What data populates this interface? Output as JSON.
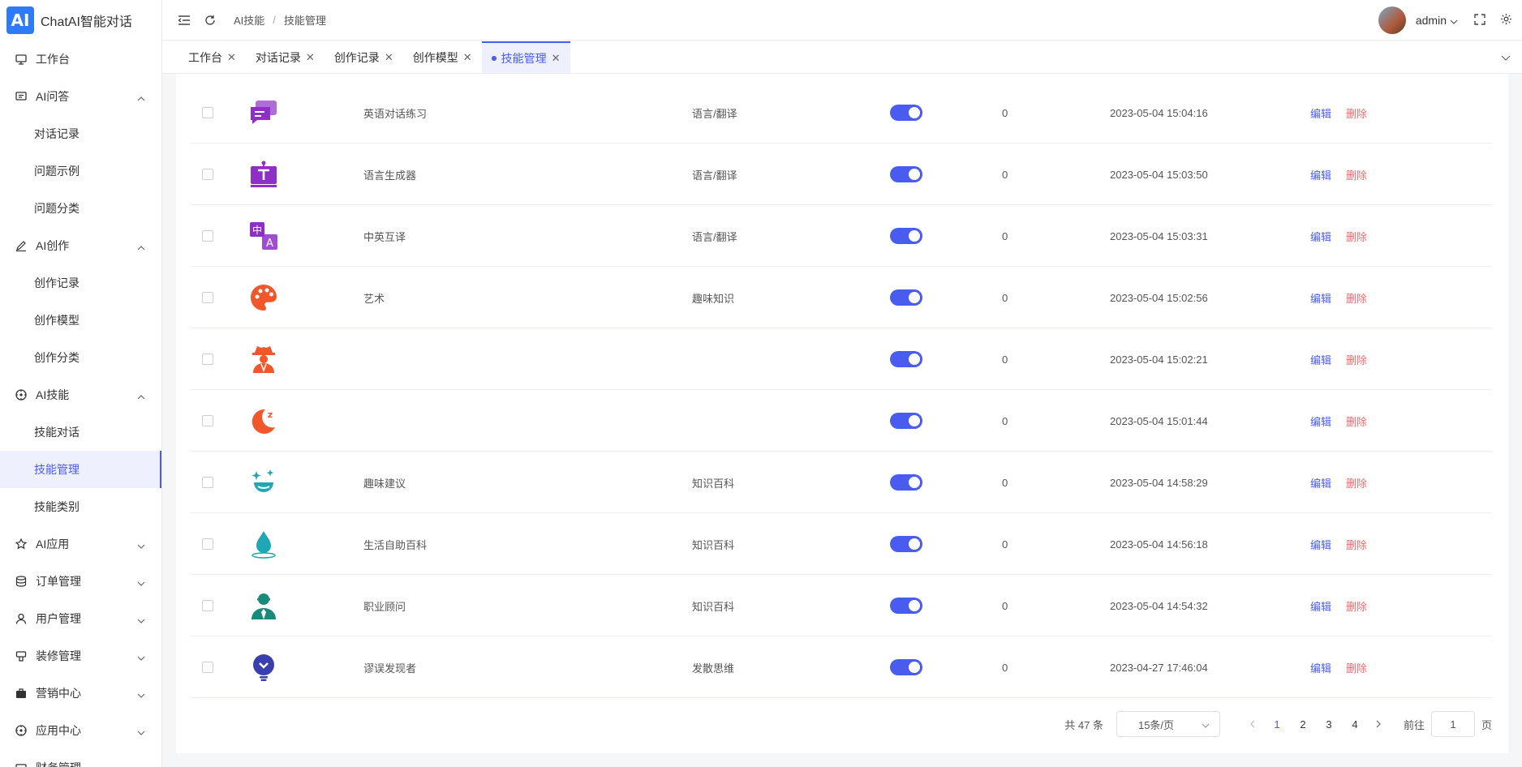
{
  "app": {
    "logo_text": "AI",
    "title": "ChatAI智能对话"
  },
  "sidebar": {
    "items": [
      {
        "label": "工作台",
        "icon": "monitor-icon",
        "expandable": false
      },
      {
        "label": "AI问答",
        "icon": "message-icon",
        "expandable": true,
        "expanded": true,
        "children": [
          {
            "label": "对话记录"
          },
          {
            "label": "问题示例"
          },
          {
            "label": "问题分类"
          }
        ]
      },
      {
        "label": "AI创作",
        "icon": "pen-icon",
        "expandable": true,
        "expanded": true,
        "children": [
          {
            "label": "创作记录"
          },
          {
            "label": "创作模型"
          },
          {
            "label": "创作分类"
          }
        ]
      },
      {
        "label": "AI技能",
        "icon": "compass-icon",
        "expandable": true,
        "expanded": true,
        "children": [
          {
            "label": "技能对话"
          },
          {
            "label": "技能管理",
            "active": true
          },
          {
            "label": "技能类别"
          }
        ]
      },
      {
        "label": "AI应用",
        "icon": "star-icon",
        "expandable": true,
        "expanded": false
      },
      {
        "label": "订单管理",
        "icon": "database-icon",
        "expandable": true,
        "expanded": false
      },
      {
        "label": "用户管理",
        "icon": "user-icon",
        "expandable": true,
        "expanded": false
      },
      {
        "label": "装修管理",
        "icon": "brush-icon",
        "expandable": true,
        "expanded": false
      },
      {
        "label": "营销中心",
        "icon": "briefcase-icon",
        "expandable": true,
        "expanded": false
      },
      {
        "label": "应用中心",
        "icon": "compass-icon",
        "expandable": true,
        "expanded": false
      },
      {
        "label": "财务管理",
        "icon": "wallet-icon",
        "expandable": true,
        "expanded": false
      }
    ]
  },
  "header": {
    "breadcrumb": [
      "AI技能",
      "技能管理"
    ],
    "username": "admin"
  },
  "tabs": [
    {
      "label": "工作台",
      "active": false
    },
    {
      "label": "对话记录",
      "active": false
    },
    {
      "label": "创作记录",
      "active": false
    },
    {
      "label": "创作模型",
      "active": false
    },
    {
      "label": "技能管理",
      "active": true
    }
  ],
  "table": {
    "rows": [
      {
        "icon": "chat-bubbles-icon",
        "icon_color": "#8e2fc7",
        "name": "英语对话练习",
        "category": "语言/翻译",
        "enabled": true,
        "count": "0",
        "time": "2023-05-04 15:04:16"
      },
      {
        "icon": "text-board-icon",
        "icon_color": "#8e2fc7",
        "name": "语言生成器",
        "category": "语言/翻译",
        "enabled": true,
        "count": "0",
        "time": "2023-05-04 15:03:50"
      },
      {
        "icon": "translate-icon",
        "icon_color": "#8e2fc7",
        "name": "中英互译",
        "category": "语言/翻译",
        "enabled": true,
        "count": "0",
        "time": "2023-05-04 15:03:31"
      },
      {
        "icon": "palette-icon",
        "icon_color": "#f2572b",
        "name": "艺术",
        "category": "趣味知识",
        "enabled": true,
        "count": "0",
        "time": "2023-05-04 15:02:56"
      },
      {
        "icon": "detective-icon",
        "icon_color": "#f2572b",
        "name": "",
        "category": "",
        "enabled": true,
        "count": "0",
        "time": "2023-05-04 15:02:21"
      },
      {
        "icon": "sleep-moon-icon",
        "icon_color": "#f2572b",
        "name": "",
        "category": "",
        "enabled": true,
        "count": "0",
        "time": "2023-05-04 15:01:44"
      },
      {
        "icon": "sparkle-face-icon",
        "icon_color": "#1fa7b5",
        "name": "趣味建议",
        "category": "知识百科",
        "enabled": true,
        "count": "0",
        "time": "2023-05-04 14:58:29"
      },
      {
        "icon": "water-drop-icon",
        "icon_color": "#1fa7b5",
        "name": "生活自助百科",
        "category": "知识百科",
        "enabled": true,
        "count": "0",
        "time": "2023-05-04 14:56:18"
      },
      {
        "icon": "advisor-icon",
        "icon_color": "#1a8a7a",
        "name": "职业顾问",
        "category": "知识百科",
        "enabled": true,
        "count": "0",
        "time": "2023-05-04 14:54:32"
      },
      {
        "icon": "lightbulb-icon",
        "icon_color": "#3a3fb0",
        "name": "谬误发现者",
        "category": "发散思维",
        "enabled": true,
        "count": "0",
        "time": "2023-04-27 17:46:04"
      }
    ],
    "edit_label": "编辑",
    "delete_label": "删除"
  },
  "pagination": {
    "total_text": "共 47 条",
    "page_size": "15条/页",
    "pages": [
      "1",
      "2",
      "3",
      "4"
    ],
    "current": "1",
    "goto_label": "前往",
    "goto_value": "1",
    "page_suffix": "页"
  }
}
